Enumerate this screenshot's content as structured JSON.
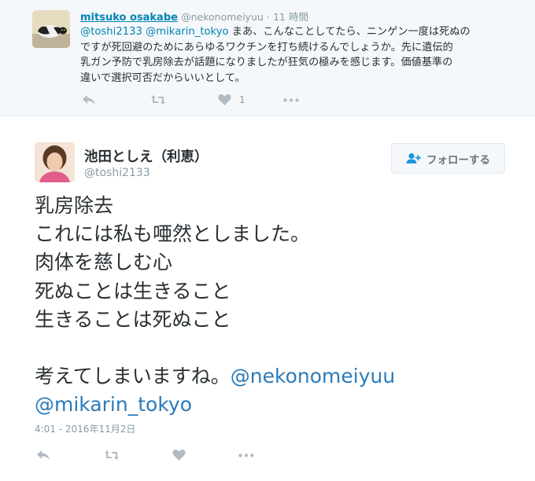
{
  "reply_tweet": {
    "display_name": "mitsuko osakabe",
    "handle": "@nekonomeiyuu",
    "separator": "·",
    "time": "11 時間",
    "mention_1": "@toshi2133",
    "mention_2": "@mikarin_tokyo",
    "text_line_1": " まあ、こんなことしてたら、ニンゲン一度は死ぬの",
    "text_line_2": "ですが死回避のためにあらゆるワクチンを打ち続けるんでしょうか。先に遺伝的",
    "text_line_3": "乳ガン予防で乳房除去が話題になりましたが狂気の極みを感じます。価値基準の",
    "text_line_4": "違いで選択可否だからいいとして。",
    "like_count": "1"
  },
  "main_tweet": {
    "display_name": "池田としえ（利恵）",
    "handle": "@toshi2133",
    "follow_label": "フォローする",
    "lines": [
      "乳房除去",
      "これには私も唖然としました。",
      "肉体を慈しむ心",
      "死ぬことは生きること",
      "生きることは死ぬこと"
    ],
    "closing_text": "考えてしまいますね。",
    "mention_1": "@nekonomeiyuu",
    "mention_2": "@mikarin_tokyo",
    "timestamp": "4:01 - 2016年11月2日"
  },
  "colors": {
    "link": "#0084b4",
    "muted": "#8899a6",
    "text": "#292f33",
    "reply_bg": "#f5f8fa"
  }
}
